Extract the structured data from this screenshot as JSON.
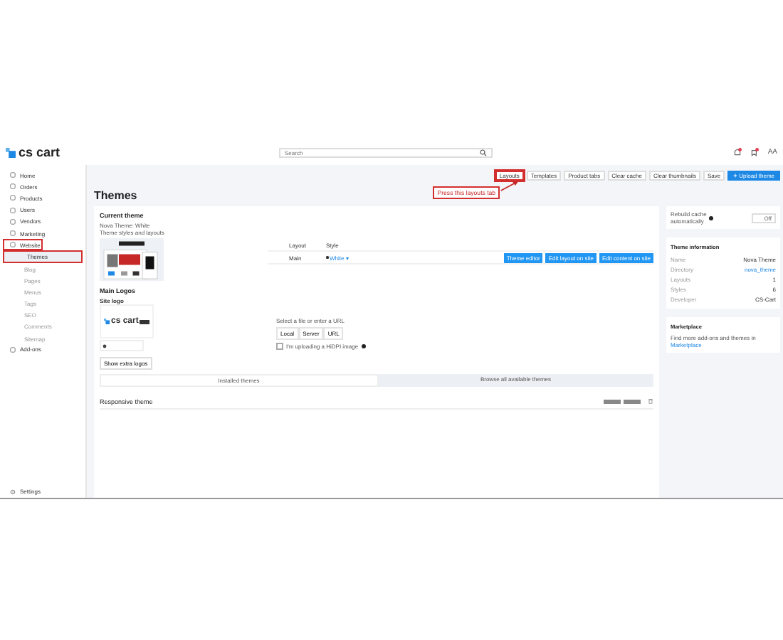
{
  "header": {
    "logo": "cs cart",
    "search": {
      "placeholder": "Search"
    },
    "avatar": "AA"
  },
  "sidebar": {
    "items": [
      {
        "label": "Home",
        "highlighted": false
      },
      {
        "label": "Orders",
        "highlighted": false
      },
      {
        "label": "Products",
        "highlighted": false
      },
      {
        "label": "Users",
        "highlighted": false
      },
      {
        "label": "Vendors",
        "highlighted": false
      },
      {
        "label": "Marketing",
        "highlighted": false
      },
      {
        "label": "Website",
        "highlighted": true,
        "children": [
          {
            "label": "Themes",
            "selected": true,
            "highlighted": true
          },
          {
            "label": "Blog",
            "selected": false,
            "highlighted": false
          },
          {
            "label": "Pages",
            "selected": false,
            "highlighted": false
          },
          {
            "label": "Menus",
            "selected": false,
            "highlighted": false
          },
          {
            "label": "Tags",
            "selected": false,
            "highlighted": false
          },
          {
            "label": "SEO",
            "selected": false,
            "highlighted": false
          },
          {
            "label": "Comments",
            "selected": false,
            "highlighted": false
          },
          {
            "label": "Sitemap",
            "selected": false,
            "highlighted": false
          }
        ]
      },
      {
        "label": "Add-ons",
        "highlighted": false
      }
    ],
    "footer": "Settings"
  },
  "toolbar": {
    "buttons": [
      {
        "label": "Layouts",
        "kind": "plain",
        "highlighted": true
      },
      {
        "label": "Templates",
        "kind": "plain",
        "highlighted": false
      },
      {
        "label": "Product tabs",
        "kind": "plain",
        "highlighted": false
      },
      {
        "label": "Clear cache",
        "kind": "plain",
        "highlighted": false
      },
      {
        "label": "Clear thumbnails",
        "kind": "plain",
        "highlighted": false
      },
      {
        "label": "Save",
        "kind": "plain",
        "highlighted": false
      },
      {
        "label": "Upload theme",
        "kind": "primary",
        "highlighted": false
      }
    ]
  },
  "callout": "Press this layouts tab",
  "page_title": "Themes",
  "current_theme": {
    "heading": "Current theme",
    "name": "Nova Theme: White",
    "subtitle": "Theme styles and layouts",
    "columns": [
      "Layout",
      "Style"
    ],
    "layout": "Main",
    "style": "White",
    "style_caret": "▾",
    "actions": [
      "Theme editor",
      "Edit layout on site",
      "Edit content on site"
    ]
  },
  "logos": {
    "heading": "Main Logos",
    "site_logo_label": "Site logo",
    "logo_text": "cs cart",
    "source_hint": "Select a file or enter a URL",
    "source_tabs": [
      "Local",
      "Server",
      "URL"
    ],
    "hidpi": {
      "label": "I'm uploading a HiDPI image",
      "checked": false
    },
    "extra_button": "Show extra logos"
  },
  "theme_tabs": [
    {
      "label": "Installed themes",
      "selected": true
    },
    {
      "label": "Browse all available themes",
      "selected": false
    }
  ],
  "responsive_theme": "Responsive theme",
  "side": {
    "rebuild": {
      "label": "Rebuild cache automatically",
      "toggle": "Off",
      "on": false
    },
    "info": {
      "title": "Theme information",
      "rows": [
        {
          "name": "Name",
          "value": "Nova Theme",
          "link": false
        },
        {
          "name": "Directory",
          "value": "nova_theme",
          "link": true
        },
        {
          "name": "Layouts",
          "value": "1",
          "link": false
        },
        {
          "name": "Styles",
          "value": "6",
          "link": false
        },
        {
          "name": "Developer",
          "value": "CS-Cart",
          "link": false
        }
      ]
    },
    "marketplace": {
      "title": "Marketplace",
      "text": "Find more add-ons and themes in",
      "link": "Marketplace"
    }
  }
}
